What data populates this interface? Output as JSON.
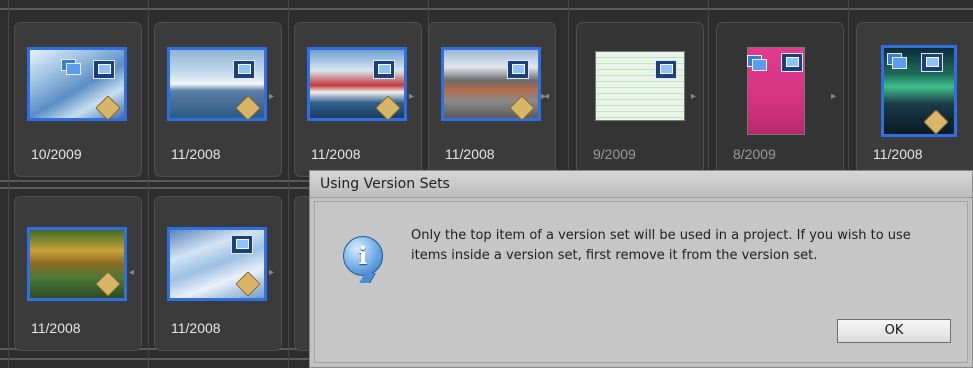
{
  "grid": {
    "row1": [
      {
        "date": "10/2009",
        "thumb": "glacier-ice"
      },
      {
        "date": "11/2008",
        "thumb": "cruise-ship"
      },
      {
        "date": "11/2008",
        "thumb": "harbor-town"
      },
      {
        "date": "11/2008",
        "thumb": "penguins-beach"
      },
      {
        "date": "9/2009",
        "thumb": "spreadsheet"
      },
      {
        "date": "8/2009",
        "thumb": "pink-flyer"
      },
      {
        "date": "11/2008",
        "thumb": "aurora"
      }
    ],
    "row2": [
      {
        "date": "11/2008",
        "thumb": "autumn-forest"
      },
      {
        "date": "11/2008",
        "thumb": "ice-cliff"
      }
    ]
  },
  "dialog": {
    "title": "Using Version Sets",
    "message": "Only the top item of a version set will be used in a project. If you wish to use items inside a version set, first remove it from the version set.",
    "ok_label": "OK",
    "icon": "info-icon"
  },
  "colors": {
    "selection_border": "#2f6fe0",
    "grid_background": "#2d2d2d",
    "dialog_background": "#c2c2c2"
  }
}
